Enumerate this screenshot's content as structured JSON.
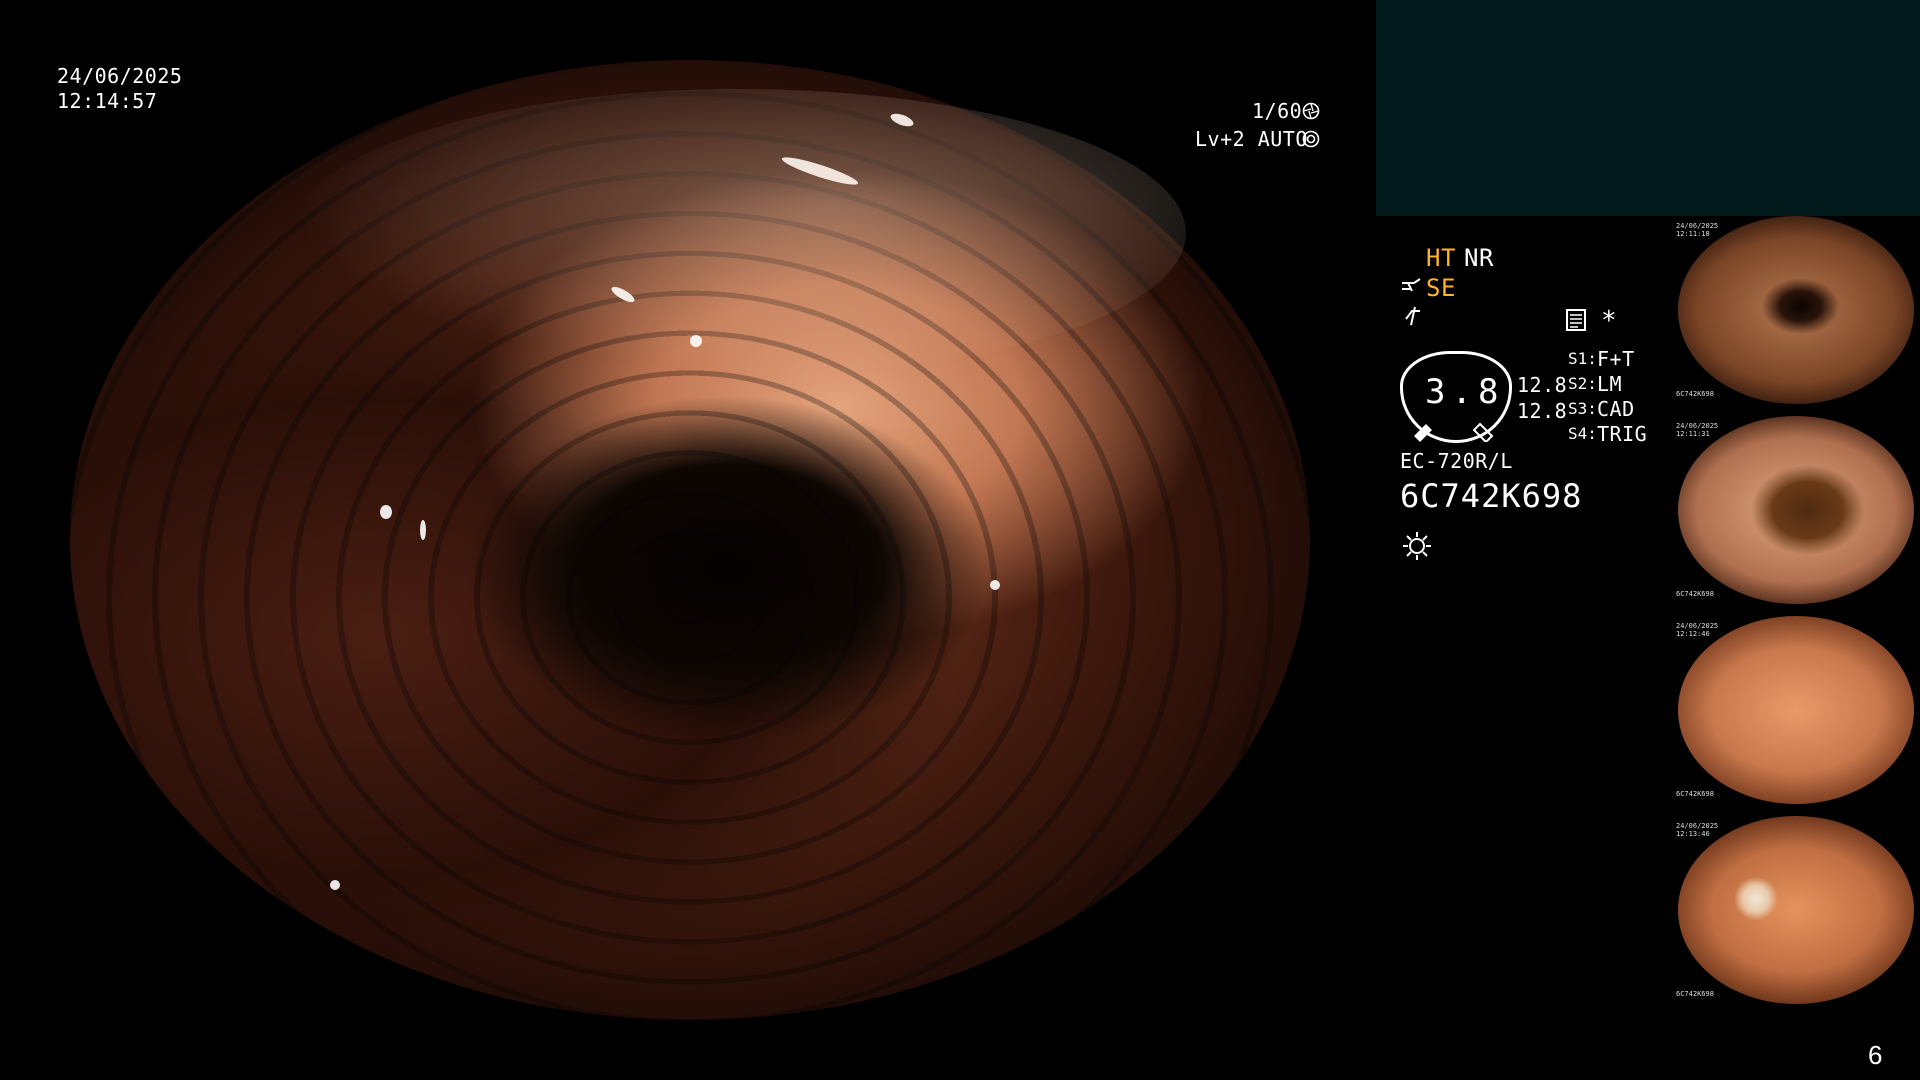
{
  "overlay": {
    "date": "24/06/2025",
    "time": "12:14:57",
    "shutter": "1/60",
    "level": "Lv+2 AUTO"
  },
  "status": {
    "ht": "HT",
    "nr": "NR",
    "se": "SE",
    "asterisk": "*",
    "gauge_value": "3.8",
    "scale_top": "12.8",
    "scale_bottom": "12.8",
    "s1_key": "S1:",
    "s1_val": "F+T",
    "s2_key": "S2:",
    "s2_val": "LM",
    "s3_key": "S3:",
    "s3_val": "CAD",
    "s4_key": "S4:",
    "s4_val": "TRIG",
    "scope_model": "EC-720R/L",
    "serial": "6C742K698"
  },
  "thumbnails": [
    {
      "date": "24/06/2025",
      "time": "12:11:18",
      "serial": "6C742K698"
    },
    {
      "date": "24/06/2025",
      "time": "12:11:31",
      "serial": "6C742K698"
    },
    {
      "date": "24/06/2025",
      "time": "12:12:46",
      "serial": "6C742K698"
    },
    {
      "date": "24/06/2025",
      "time": "12:13:46",
      "serial": "6C742K698"
    }
  ],
  "page_number": "6",
  "colors": {
    "highlight": "#ffb22a",
    "info_box": "#031a1c",
    "background": "#000000"
  },
  "icons": {
    "shutter": "aperture-icon",
    "auto": "iris-icon",
    "se": "scope-tip-icon",
    "freeze": "freeze-icon",
    "memo": "memo-icon",
    "light": "light-icon"
  }
}
